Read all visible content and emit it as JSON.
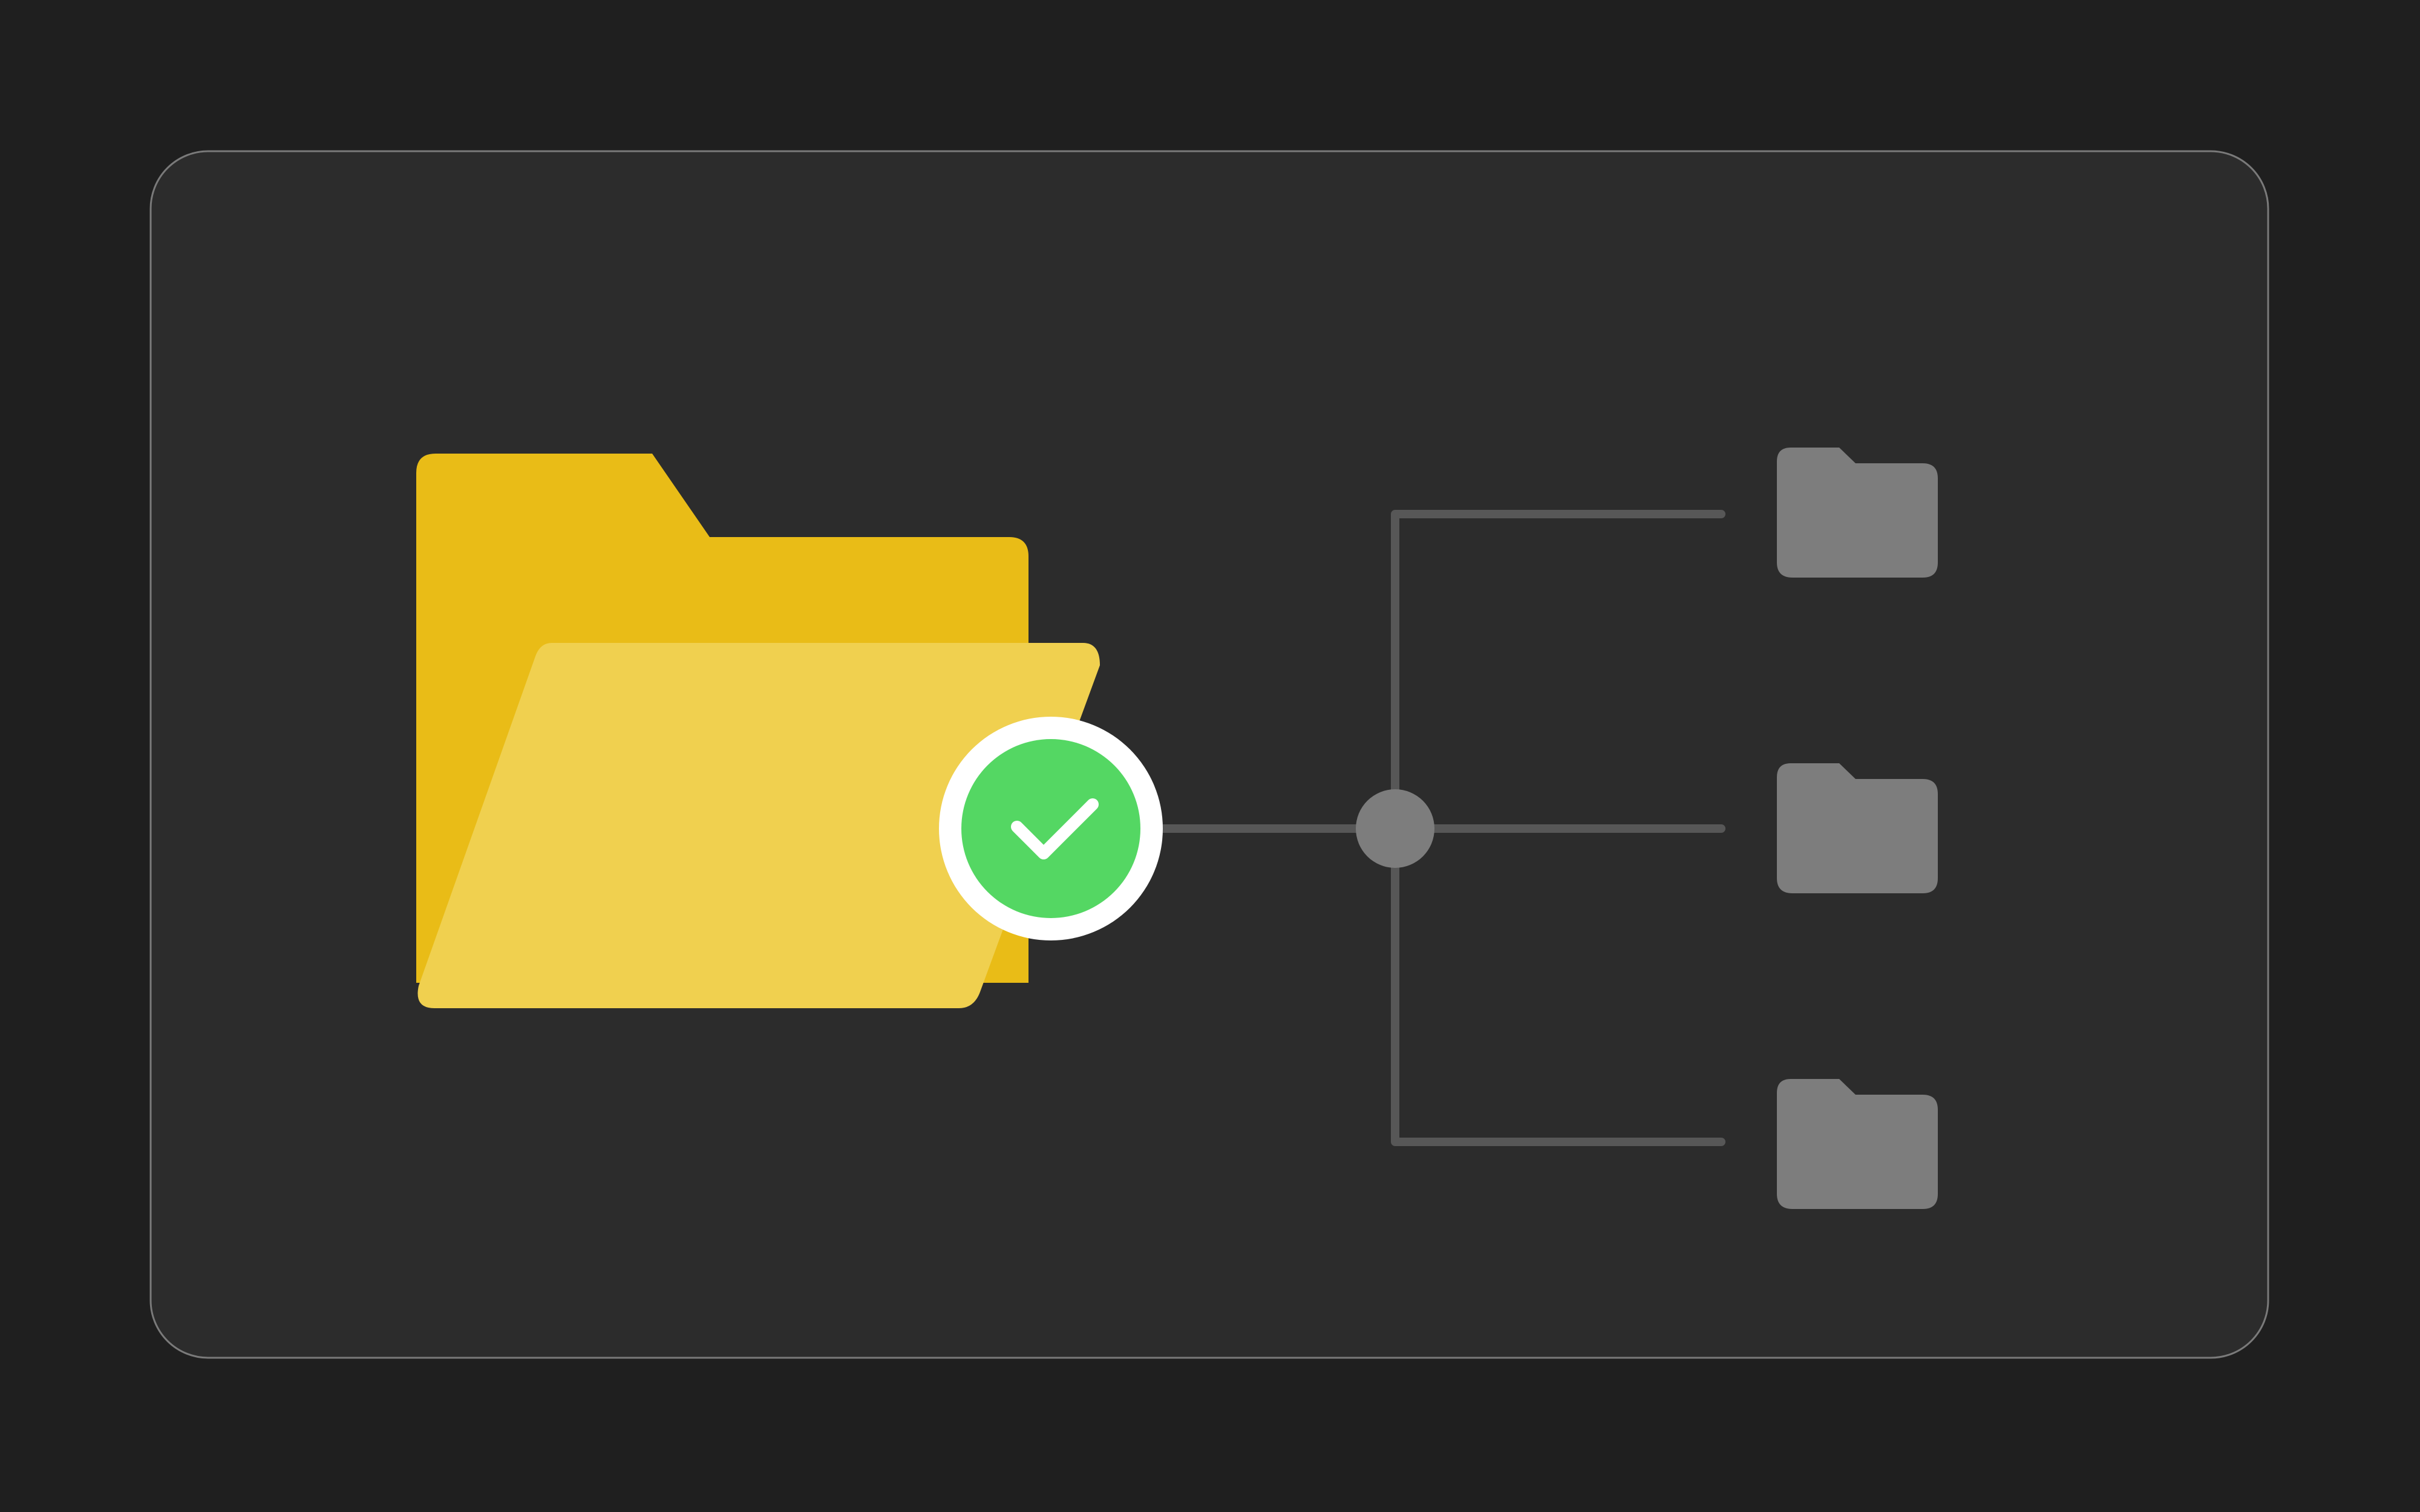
{
  "colors": {
    "page_background": "#1f1f1f",
    "card_background": "#2c2c2c",
    "card_border": "#7a7a7a",
    "folder_back": "#e9bc17",
    "folder_front": "#f0d04f",
    "check_badge_fill": "#54d763",
    "check_badge_ring": "#ffffff",
    "checkmark": "#ffffff",
    "connector_line": "#575757",
    "junction_node": "#7d7d7d",
    "subfolder": "#7d7d7d"
  },
  "icons": {
    "main": "open-folder-icon",
    "status": "check-circle-icon",
    "junction": "junction-node",
    "children": [
      "folder-icon",
      "folder-icon",
      "folder-icon"
    ]
  }
}
